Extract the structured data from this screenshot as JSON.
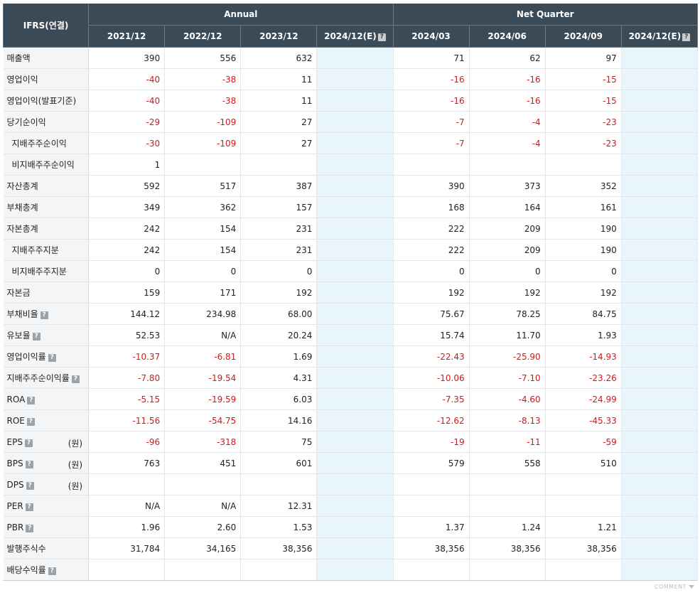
{
  "header": {
    "corner": "IFRS(연결)",
    "annual": "Annual",
    "quarter": "Net Quarter",
    "annual_cols": [
      "2021/12",
      "2022/12",
      "2023/12",
      "2024/12(E)"
    ],
    "quarter_cols": [
      "2024/03",
      "2024/06",
      "2024/09",
      "2024/12(E)"
    ]
  },
  "rows": [
    {
      "label": "매출액",
      "vals": [
        "390",
        "556",
        "632",
        "",
        "71",
        "62",
        "97",
        ""
      ]
    },
    {
      "label": "영업이익",
      "vals": [
        "-40",
        "-38",
        "11",
        "",
        "-16",
        "-16",
        "-15",
        ""
      ]
    },
    {
      "label": "영업이익(발표기준)",
      "vals": [
        "-40",
        "-38",
        "11",
        "",
        "-16",
        "-16",
        "-15",
        ""
      ]
    },
    {
      "label": "당기순이익",
      "vals": [
        "-29",
        "-109",
        "27",
        "",
        "-7",
        "-4",
        "-23",
        ""
      ]
    },
    {
      "label": "지배주주순이익",
      "sub": true,
      "vals": [
        "-30",
        "-109",
        "27",
        "",
        "-7",
        "-4",
        "-23",
        ""
      ]
    },
    {
      "label": "비지배주주순이익",
      "sub": true,
      "vals": [
        "1",
        "",
        "",
        "",
        "",
        "",
        "",
        ""
      ]
    },
    {
      "label": "자산총계",
      "vals": [
        "592",
        "517",
        "387",
        "",
        "390",
        "373",
        "352",
        ""
      ]
    },
    {
      "label": "부채총계",
      "vals": [
        "349",
        "362",
        "157",
        "",
        "168",
        "164",
        "161",
        ""
      ]
    },
    {
      "label": "자본총계",
      "vals": [
        "242",
        "154",
        "231",
        "",
        "222",
        "209",
        "190",
        ""
      ]
    },
    {
      "label": "지배주주지분",
      "sub": true,
      "vals": [
        "242",
        "154",
        "231",
        "",
        "222",
        "209",
        "190",
        ""
      ]
    },
    {
      "label": "비지배주주지분",
      "sub": true,
      "vals": [
        "0",
        "0",
        "0",
        "",
        "0",
        "0",
        "0",
        ""
      ]
    },
    {
      "label": "자본금",
      "vals": [
        "159",
        "171",
        "192",
        "",
        "192",
        "192",
        "192",
        ""
      ]
    },
    {
      "label": "부채비율",
      "help": true,
      "vals": [
        "144.12",
        "234.98",
        "68.00",
        "",
        "75.67",
        "78.25",
        "84.75",
        ""
      ]
    },
    {
      "label": "유보율",
      "help": true,
      "vals": [
        "52.53",
        "N/A",
        "20.24",
        "",
        "15.74",
        "11.70",
        "1.93",
        ""
      ]
    },
    {
      "label": "영업이익률",
      "help": true,
      "vals": [
        "-10.37",
        "-6.81",
        "1.69",
        "",
        "-22.43",
        "-25.90",
        "-14.93",
        ""
      ]
    },
    {
      "label": "지배주주순이익률",
      "help": true,
      "vals": [
        "-7.80",
        "-19.54",
        "4.31",
        "",
        "-10.06",
        "-7.10",
        "-23.26",
        ""
      ]
    },
    {
      "label": "ROA",
      "help": true,
      "vals": [
        "-5.15",
        "-19.59",
        "6.03",
        "",
        "-7.35",
        "-4.60",
        "-24.99",
        ""
      ]
    },
    {
      "label": "ROE",
      "help": true,
      "vals": [
        "-11.56",
        "-54.75",
        "14.16",
        "",
        "-12.62",
        "-8.13",
        "-45.33",
        ""
      ]
    },
    {
      "label": "EPS",
      "help": true,
      "unit": "(원)",
      "vals": [
        "-96",
        "-318",
        "75",
        "",
        "-19",
        "-11",
        "-59",
        ""
      ]
    },
    {
      "label": "BPS",
      "help": true,
      "unit": "(원)",
      "vals": [
        "763",
        "451",
        "601",
        "",
        "579",
        "558",
        "510",
        ""
      ]
    },
    {
      "label": "DPS",
      "help": true,
      "unit": "(원)",
      "vals": [
        "",
        "",
        "",
        "",
        "",
        "",
        "",
        ""
      ]
    },
    {
      "label": "PER",
      "help": true,
      "vals": [
        "N/A",
        "N/A",
        "12.31",
        "",
        "",
        "",
        "",
        ""
      ]
    },
    {
      "label": "PBR",
      "help": true,
      "vals": [
        "1.96",
        "2.60",
        "1.53",
        "",
        "1.37",
        "1.24",
        "1.21",
        ""
      ]
    },
    {
      "label": "발행주식수",
      "vals": [
        "31,784",
        "34,165",
        "38,356",
        "",
        "38,356",
        "38,356",
        "38,356",
        ""
      ]
    },
    {
      "label": "배당수익률",
      "help": true,
      "vals": [
        "",
        "",
        "",
        "",
        "",
        "",
        "",
        ""
      ]
    }
  ],
  "help_icon": "?",
  "footer": {
    "comment": "COMMENT"
  },
  "colors": {
    "header_bg": "#3b4a57",
    "negative": "#d11a1a",
    "estimate_bg": "#e8f5fa",
    "label_bg": "#f4f5f6"
  }
}
